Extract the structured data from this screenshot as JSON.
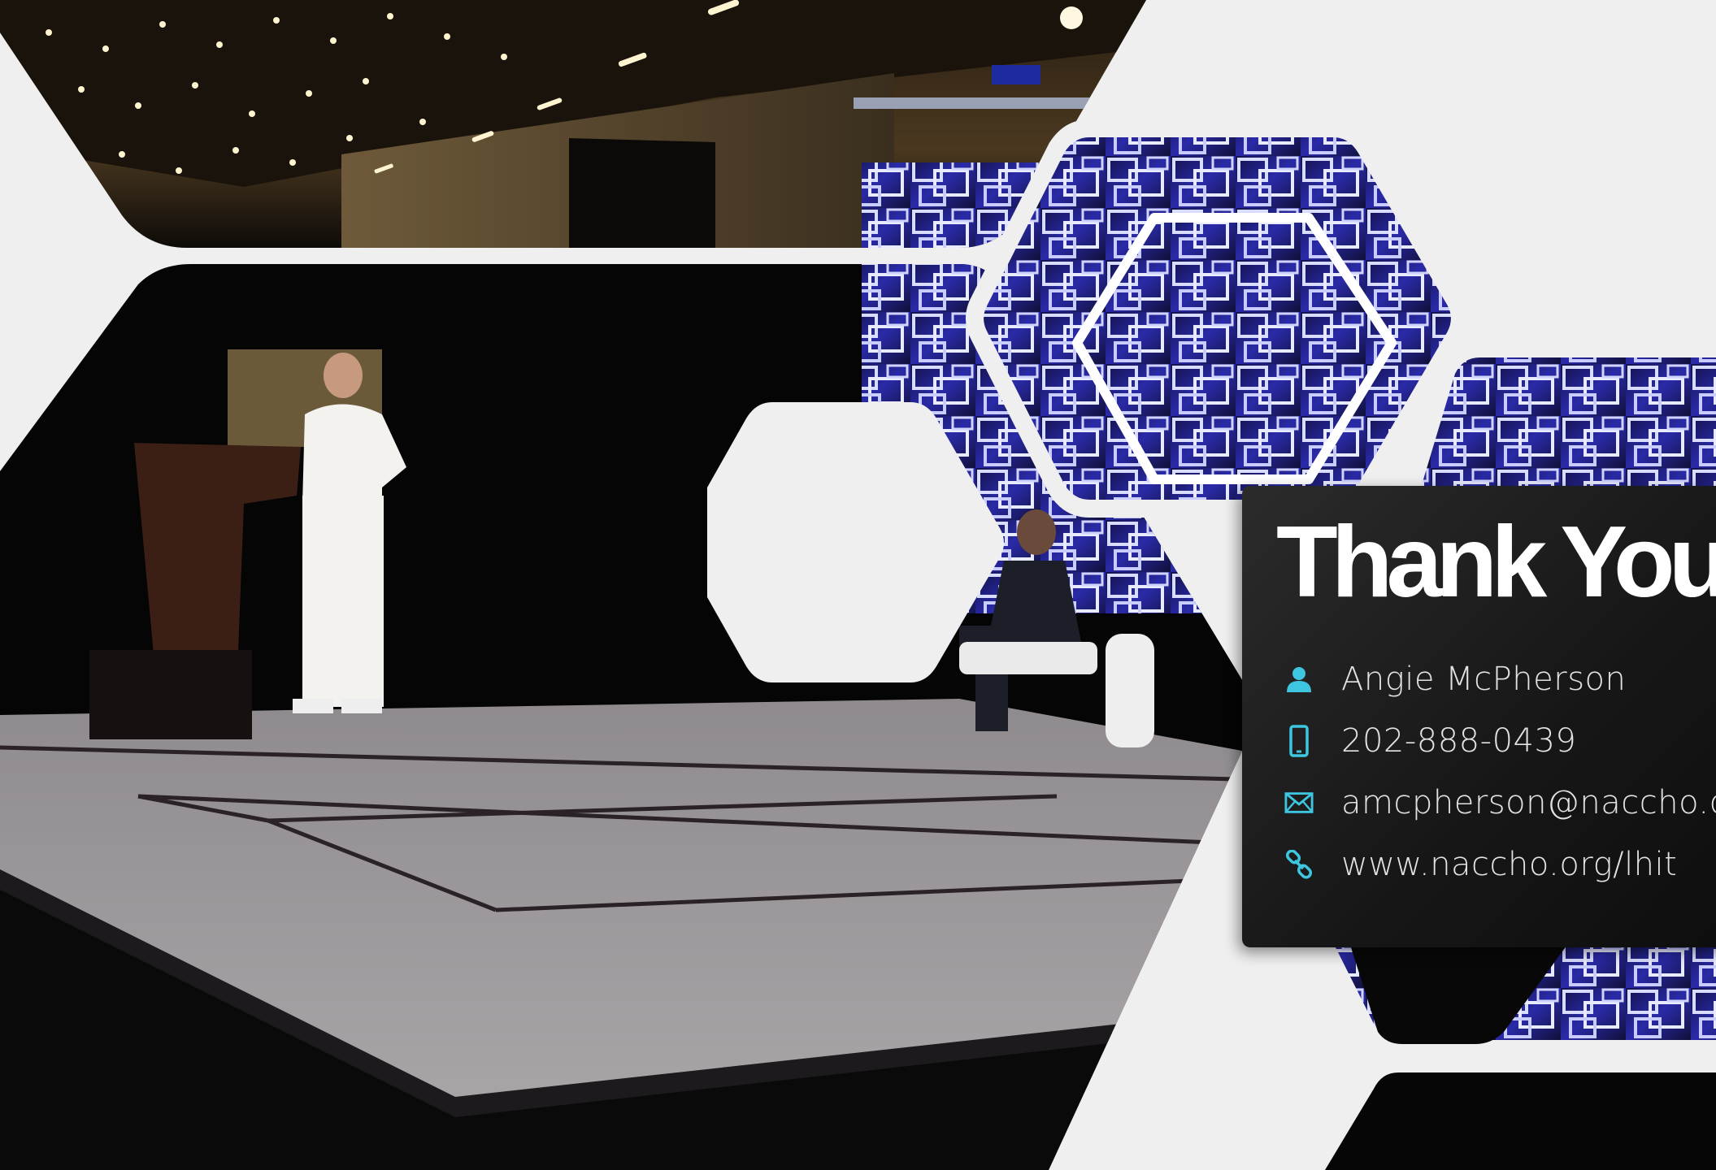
{
  "slide": {
    "title": "Thank You",
    "contacts": [
      {
        "icon": "person-icon",
        "text": "Angie McPherson"
      },
      {
        "icon": "phone-icon",
        "text": "202-888-0439"
      },
      {
        "icon": "email-icon",
        "text": "amcpherson@naccho.or"
      },
      {
        "icon": "link-icon",
        "text": "www.naccho.org/lhit"
      }
    ]
  },
  "colors": {
    "background": "#efefef",
    "card": "#1c1c1c",
    "accent": "#3ec6e0",
    "title": "#ffffff"
  }
}
